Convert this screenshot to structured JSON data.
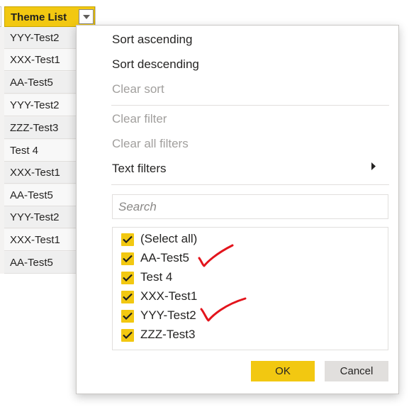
{
  "column_header": {
    "title": "Theme List",
    "dropdown_icon": "triangle-down-icon"
  },
  "grid_rows": [
    "YYY-Test2",
    "XXX-Test1",
    "AA-Test5",
    "YYY-Test2",
    "ZZZ-Test3",
    "Test 4",
    "XXX-Test1",
    "AA-Test5",
    "YYY-Test2",
    "XXX-Test1",
    "AA-Test5"
  ],
  "menu": {
    "sort_ascending": "Sort ascending",
    "sort_descending": "Sort descending",
    "clear_sort": "Clear sort",
    "clear_filter": "Clear filter",
    "clear_all_filters": "Clear all filters",
    "text_filters": "Text filters",
    "submenu_icon": "triangle-right-icon"
  },
  "search": {
    "placeholder": "Search",
    "value": ""
  },
  "filter_list": [
    {
      "label": "(Select all)",
      "checked": true
    },
    {
      "label": "AA-Test5",
      "checked": true
    },
    {
      "label": "Test 4",
      "checked": true
    },
    {
      "label": "XXX-Test1",
      "checked": true
    },
    {
      "label": "YYY-Test2",
      "checked": true
    },
    {
      "label": "ZZZ-Test3",
      "checked": true
    }
  ],
  "buttons": {
    "ok": "OK",
    "cancel": "Cancel"
  },
  "colors": {
    "accent": "#f2c811",
    "annotation": "#e3141c",
    "disabled_text": "#a19f9d"
  }
}
